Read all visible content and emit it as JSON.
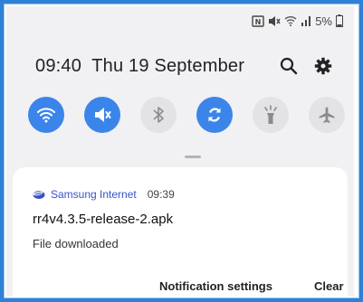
{
  "status_bar": {
    "battery": "5%",
    "icons": [
      "nfc-icon",
      "mute-icon",
      "wifi-icon",
      "signal-icon",
      "battery-icon"
    ]
  },
  "header": {
    "time": "09:40",
    "date": "Thu 19 September",
    "icons": [
      "search-icon",
      "settings-gear-icon"
    ]
  },
  "quick_settings": {
    "tiles": [
      {
        "icon": "wifi-icon",
        "state": "on"
      },
      {
        "icon": "mute-icon",
        "state": "on"
      },
      {
        "icon": "bluetooth-icon",
        "state": "off"
      },
      {
        "icon": "auto-rotate-icon",
        "state": "on"
      },
      {
        "icon": "flashlight-icon",
        "state": "off"
      },
      {
        "icon": "airplane-icon",
        "state": "off"
      }
    ],
    "accent_color": "#3b85ea"
  },
  "notification": {
    "app_name": "Samsung Internet",
    "time": "09:39",
    "title": "rr4v4.3.5-release-2.apk",
    "subtitle": "File downloaded",
    "actions": {
      "settings_label": "Notification settings",
      "clear_label": "Clear"
    },
    "app_color": "#3a52c8"
  }
}
